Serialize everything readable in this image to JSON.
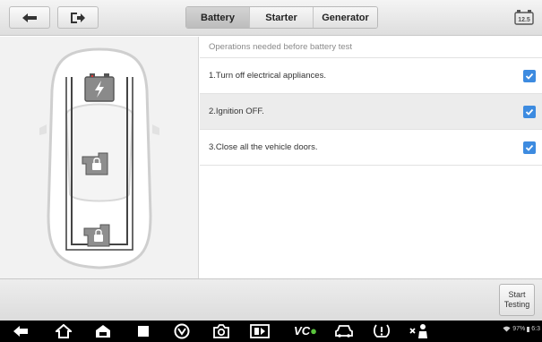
{
  "tabs": [
    {
      "label": "Battery",
      "active": true
    },
    {
      "label": "Starter",
      "active": false
    },
    {
      "label": "Generator",
      "active": false
    }
  ],
  "checklist": {
    "header": "Operations needed before battery test",
    "items": [
      {
        "text": "1.Turn off electrical appliances.",
        "checked": true
      },
      {
        "text": "2.Ignition OFF.",
        "checked": true
      },
      {
        "text": "3.Close all the vehicle doors.",
        "checked": true
      }
    ]
  },
  "start_button": {
    "line1": "Start",
    "line2": "Testing"
  },
  "battery_badge": "12.5",
  "status_bar": {
    "battery_percent": "97%",
    "time": "6:3"
  },
  "vci": {
    "label": "VC"
  },
  "colors": {
    "accent": "#3d8be0",
    "vci_connected": "#5ac43c"
  },
  "icons": [
    "back-arrow-icon",
    "exit-icon",
    "battery-voltage-icon",
    "car-outline-icon",
    "battery-icon",
    "lock-icon",
    "check-icon",
    "nav-back-icon",
    "home-icon",
    "car-home-icon",
    "recent-apps-icon",
    "browser-icon",
    "camera-icon",
    "screen-record-icon",
    "vci-icon",
    "car-icon",
    "tpms-icon",
    "mechanic-icon",
    "wifi-icon"
  ]
}
